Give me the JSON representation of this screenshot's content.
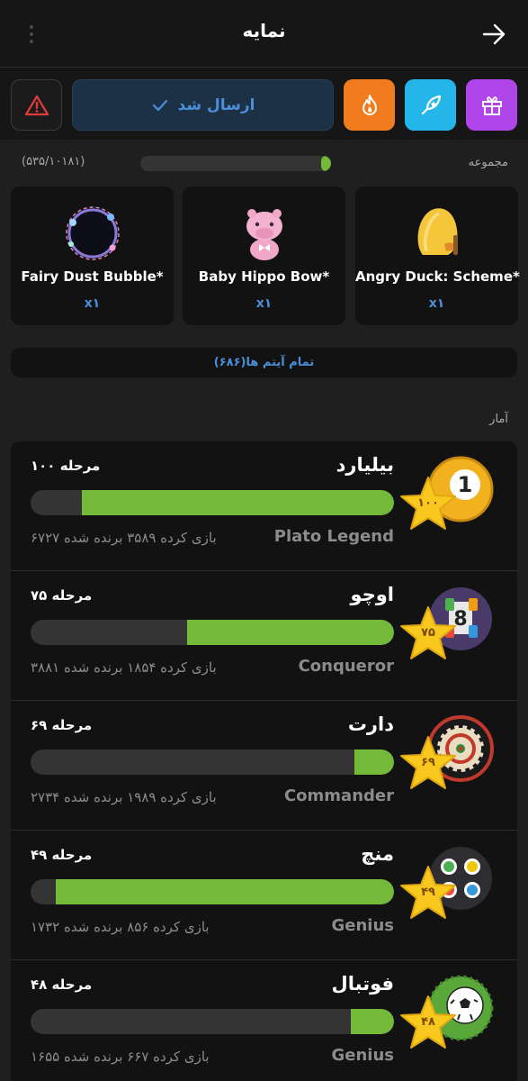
{
  "header": {
    "title": "نمایه",
    "back_icon": "arrow-right-icon",
    "menu_icon": "more-vertical-icon"
  },
  "actions": {
    "sent_label": "ارسال شد",
    "sent_icon": "check-icon",
    "warning_icon": "warning-icon",
    "fire_icon": "fire-icon",
    "boost_icon": "rocket-star-icon",
    "gift_icon": "gift-icon",
    "colors": {
      "fire": "#f07c1d",
      "boost": "#25b6e9",
      "gift": "#b046ea",
      "warning": "#e03a3a",
      "accent": "#4a8fd8"
    }
  },
  "collection": {
    "label": "مجموعه",
    "count_text": "(۵۳۵/۱۰۱۸۱)",
    "progress_fraction": 0.0526
  },
  "items": [
    {
      "name": "Angry Duck: Scheme*",
      "qty": "x۱",
      "icon": "angry-duck-sticker-icon"
    },
    {
      "name": "Baby Hippo Bow*",
      "qty": "x۱",
      "icon": "baby-hippo-sticker-icon"
    },
    {
      "name": "Fairy Dust Bubble*",
      "qty": "x۱",
      "icon": "fairy-dust-bubble-icon"
    }
  ],
  "all_items_label": "تمام آیتم ها(۶۸۶)",
  "stats_label": "آمار",
  "stats": [
    {
      "game": "بیلیارد",
      "level": "مرحله ۱۰۰",
      "star": "۱۰۰",
      "rank": "Plato Legend",
      "games": "۶۷۲۷ بازی کرده   ۳۵۸۹ برنده شده",
      "progress": 0.86,
      "icon": "billiard-ball-icon"
    },
    {
      "game": "اوچو",
      "level": "مرحله ۷۵",
      "star": "۷۵",
      "rank": "Conqueror",
      "games": "۳۸۸۱ بازی کرده   ۱۸۵۴ برنده شده",
      "progress": 0.57,
      "icon": "ocho-card-icon"
    },
    {
      "game": "دارت",
      "level": "مرحله ۶۹",
      "star": "۶۹",
      "rank": "Commander",
      "games": "۲۷۳۴ بازی کرده   ۱۹۸۹ برنده شده",
      "progress": 0.11,
      "icon": "dartboard-icon"
    },
    {
      "game": "منچ",
      "level": "مرحله ۴۹",
      "star": "۴۹",
      "rank": "Genius",
      "games": "۱۷۳۲ بازی کرده   ۸۵۶ برنده شده",
      "progress": 0.93,
      "icon": "ludo-icon"
    },
    {
      "game": "فوتبال",
      "level": "مرحله ۴۸",
      "star": "۴۸",
      "rank": "Genius",
      "games": "۱۶۵۵ بازی کرده   ۶۶۷ برنده شده",
      "progress": 0.12,
      "icon": "soccer-ball-icon"
    }
  ]
}
